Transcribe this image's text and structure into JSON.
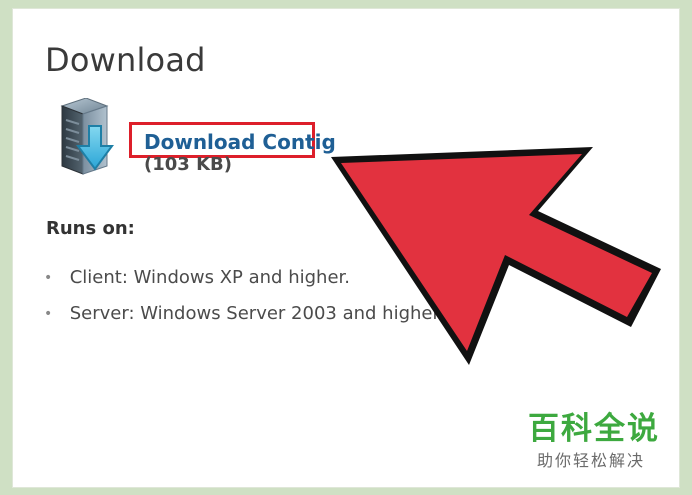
{
  "page": {
    "title": "Download"
  },
  "download": {
    "link_text": "Download Contig",
    "size_text": "(103 KB)"
  },
  "requirements": {
    "heading": "Runs on:",
    "items": [
      "Client: Windows XP and higher.",
      "Server: Windows Server 2003 and higher."
    ]
  },
  "watermark": {
    "main": "百科全说",
    "sub": "助你轻松解决"
  },
  "icons": {
    "server_download": "server-download-icon",
    "bullet": "bullet-icon",
    "annotation_arrow": "arrow-icon"
  },
  "colors": {
    "background": "#cfe0c4",
    "card": "#ffffff",
    "link": "#1f5f95",
    "highlight_border": "#dd1f2a",
    "arrow_fill": "#e2323f",
    "arrow_outline": "#111111",
    "watermark_green": "#3da93f"
  }
}
